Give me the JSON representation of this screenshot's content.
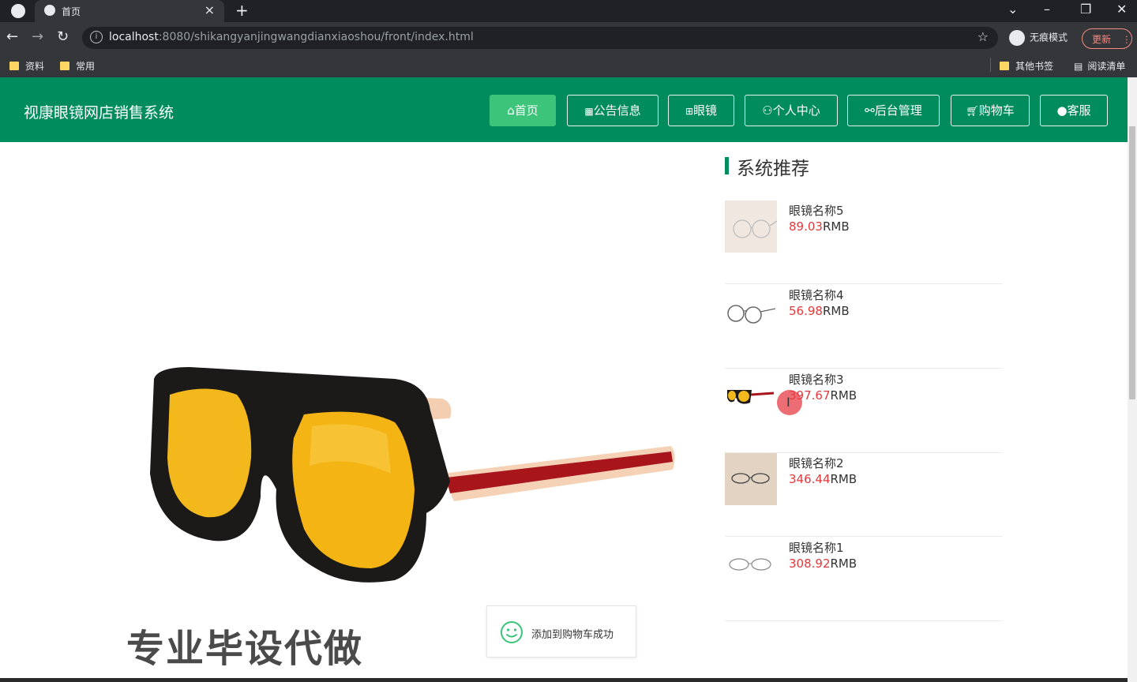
{
  "browser": {
    "tab_title": "首页",
    "url_host": "localhost",
    "url_path": ":8080/shikangyanjingwangdianxiaoshou/front/index.html",
    "incognito_label": "无痕模式",
    "update_label": "更新",
    "bookmarks": [
      {
        "label": "资料"
      },
      {
        "label": "常用"
      }
    ],
    "other_bookmarks": "其他书签",
    "reading_list": "阅读清单"
  },
  "site": {
    "title": "视康眼镜网店销售系统",
    "nav": [
      {
        "label": "首页",
        "icon": "home-icon",
        "active": true
      },
      {
        "label": "公告信息",
        "icon": "gift-icon",
        "active": false
      },
      {
        "label": "眼镜",
        "icon": "grid-icon",
        "active": false
      },
      {
        "label": "个人中心",
        "icon": "user-icon",
        "active": false
      },
      {
        "label": "后台管理",
        "icon": "link-icon",
        "active": false
      },
      {
        "label": "购物车",
        "icon": "cart-icon",
        "active": false
      },
      {
        "label": "客服",
        "icon": "chat-icon",
        "active": false
      }
    ],
    "accent_color": "#008c5d",
    "active_color": "#3cc47a",
    "price_color": "#e4393c"
  },
  "watermark": "专业毕设代做",
  "recommend": {
    "title": "系统推荐",
    "items": [
      {
        "name": "眼镜名称5",
        "price": "89.03",
        "unit": "RMB"
      },
      {
        "name": "眼镜名称4",
        "price": "56.98",
        "unit": "RMB"
      },
      {
        "name": "眼镜名称3",
        "price": "397.67",
        "unit": "RMB"
      },
      {
        "name": "眼镜名称2",
        "price": "346.44",
        "unit": "RMB"
      },
      {
        "name": "眼镜名称1",
        "price": "308.92",
        "unit": "RMB"
      }
    ]
  },
  "toast": {
    "message": "添加到购物车成功"
  }
}
